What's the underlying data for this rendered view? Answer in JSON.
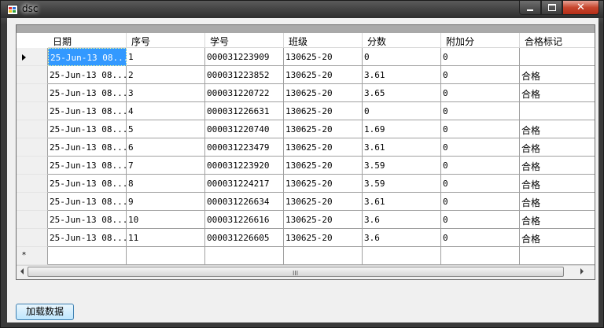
{
  "window": {
    "title": "dsc"
  },
  "grid": {
    "columns": [
      "日期",
      "序号",
      "学号",
      "班级",
      "分数",
      "附加分",
      "合格标记"
    ],
    "rows": [
      [
        "25-Jun-13 08...",
        "1",
        "000031223909",
        "130625-20",
        "0",
        "0",
        ""
      ],
      [
        "25-Jun-13 08...",
        "2",
        "000031223852",
        "130625-20",
        "3.61",
        "0",
        "合格"
      ],
      [
        "25-Jun-13 08...",
        "3",
        "000031220722",
        "130625-20",
        "3.65",
        "0",
        "合格"
      ],
      [
        "25-Jun-13 08...",
        "4",
        "000031226631",
        "130625-20",
        "0",
        "0",
        ""
      ],
      [
        "25-Jun-13 08...",
        "5",
        "000031220740",
        "130625-20",
        "1.69",
        "0",
        "合格"
      ],
      [
        "25-Jun-13 08...",
        "6",
        "000031223479",
        "130625-20",
        "3.61",
        "0",
        "合格"
      ],
      [
        "25-Jun-13 08...",
        "7",
        "000031223920",
        "130625-20",
        "3.59",
        "0",
        "合格"
      ],
      [
        "25-Jun-13 08...",
        "8",
        "000031224217",
        "130625-20",
        "3.59",
        "0",
        "合格"
      ],
      [
        "25-Jun-13 08...",
        "9",
        "000031226634",
        "130625-20",
        "3.61",
        "0",
        "合格"
      ],
      [
        "25-Jun-13 08...",
        "10",
        "000031226616",
        "130625-20",
        "3.6",
        "0",
        "合格"
      ],
      [
        "25-Jun-13 08...",
        "11",
        "000031226605",
        "130625-20",
        "3.6",
        "0",
        "合格"
      ]
    ],
    "current_row_marker": "▶",
    "new_row_marker": "*",
    "scroll_grip": "III"
  },
  "buttons": {
    "load_label": "加载数据"
  },
  "icons": {
    "app": "app-icon",
    "minimize": "minimize-icon",
    "maximize": "maximize-icon",
    "close": "close-icon"
  },
  "colors": {
    "selection": "#3399ff",
    "close_button": "#c7462e"
  }
}
